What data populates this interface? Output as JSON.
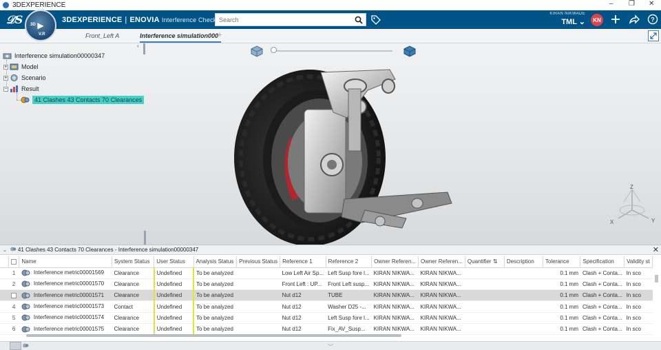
{
  "window": {
    "title": "3DEXPERIENCE",
    "controls": [
      "–",
      "❐",
      "✕"
    ]
  },
  "header": {
    "brand_bold": "3DEXPERIENCE",
    "brand_sep": "|",
    "brand_app": "ENOVIA",
    "brand_sub": "Interference Check",
    "compass_3d": "3D",
    "compass_vr": "V.R",
    "search_placeholder": "Search",
    "user_name": "KIRAN NIKWADE",
    "tenant": "TML",
    "avatar_initials": "KN"
  },
  "tabs": [
    {
      "label": "Front_Left A",
      "active": false
    },
    {
      "label": "Interference simulation000",
      "active": true
    }
  ],
  "tree": {
    "root": "Interference simulation00000347",
    "children": [
      "Model",
      "Scenario",
      "Result"
    ],
    "result_item": "41 Clashes  43 Contacts  70 Clearances"
  },
  "viewport": {
    "axis_x": "X",
    "axis_y": "Y",
    "axis_z": "Z"
  },
  "panel": {
    "title": "41 Clashes 43 Contacts 70 Clearances - Interference simulation00000347",
    "columns": [
      "Name",
      "System Status",
      "User Status",
      "Analysis Status",
      "Previous Status",
      "Reference 1",
      "Reference 2",
      "Owner Referen...",
      "Owner Referen...",
      "Quantifier",
      "Description",
      "Tolerance",
      "Specification",
      "Validity st"
    ],
    "rows": [
      {
        "n": "1",
        "name": "Interference metric00001569",
        "sys": "Clearance",
        "user": "Undefined",
        "analysis": "To be analyzed",
        "prev": "",
        "ref1": "Low Left Air Sp...",
        "ref2": "Left Susp fore l...",
        "own1": "KIRAN  NIKWA...",
        "own2": "KIRAN  NIKWA...",
        "quant": "",
        "desc": "",
        "tol": "0.1 mm",
        "spec": "Clash + Conta...",
        "valid": "In sco"
      },
      {
        "n": "2",
        "name": "Interference metric00001570",
        "sys": "Clearance",
        "user": "Undefined",
        "analysis": "To be analyzed",
        "prev": "",
        "ref1": "Front Left : UP...",
        "ref2": "Front Left susp...",
        "own1": "KIRAN  NIKWA...",
        "own2": "KIRAN  NIKWA...",
        "quant": "",
        "desc": "",
        "tol": "0.1 mm",
        "spec": "Clash + Conta...",
        "valid": "In sco"
      },
      {
        "n": "",
        "name": "Interference metric00001571",
        "sys": "Clearance",
        "user": "Undefined",
        "analysis": "To be analyzed",
        "prev": "",
        "ref1": "Nut d12",
        "ref2": "TUBE",
        "own1": "KIRAN  NIKWA...",
        "own2": "KIRAN  NIKWA...",
        "quant": "",
        "desc": "",
        "tol": "0.1 mm",
        "spec": "Clash + Conta...",
        "valid": "In sco"
      },
      {
        "n": "4",
        "name": "Interference metric00001573",
        "sys": "Contact",
        "user": "Undefined",
        "analysis": "To be analyzed",
        "prev": "",
        "ref1": "Nut d12",
        "ref2": "Washer D25 -...",
        "own1": "KIRAN  NIKWA...",
        "own2": "KIRAN  NIKWA...",
        "quant": "",
        "desc": "",
        "tol": "0.1 mm",
        "spec": "Clash + Conta...",
        "valid": "In sco"
      },
      {
        "n": "5",
        "name": "Interference metric00001574",
        "sys": "Clearance",
        "user": "Undefined",
        "analysis": "To be analyzed",
        "prev": "",
        "ref1": "Nut d12",
        "ref2": "Left Susp fore l...",
        "own1": "KIRAN  NIKWA...",
        "own2": "KIRAN  NIKWA...",
        "quant": "",
        "desc": "",
        "tol": "0.1 mm",
        "spec": "Clash + Conta...",
        "valid": "In sco"
      },
      {
        "n": "6",
        "name": "Interference metric00001575",
        "sys": "Clearance",
        "user": "Undefined",
        "analysis": "To be analyzed",
        "prev": "",
        "ref1": "Nut d12",
        "ref2": "Fix_AV_Susp...",
        "own1": "KIRAN  NIKWA...",
        "own2": "KIRAN  NIKWA...",
        "quant": "",
        "desc": "",
        "tol": "0.1 mm",
        "spec": "Clash + Conta...",
        "valid": "In sco"
      }
    ]
  },
  "colors": {
    "topbar": "#005386",
    "selection": "#43d1c7",
    "status_bar": "#e7e231",
    "avatar": "#d9454e"
  }
}
